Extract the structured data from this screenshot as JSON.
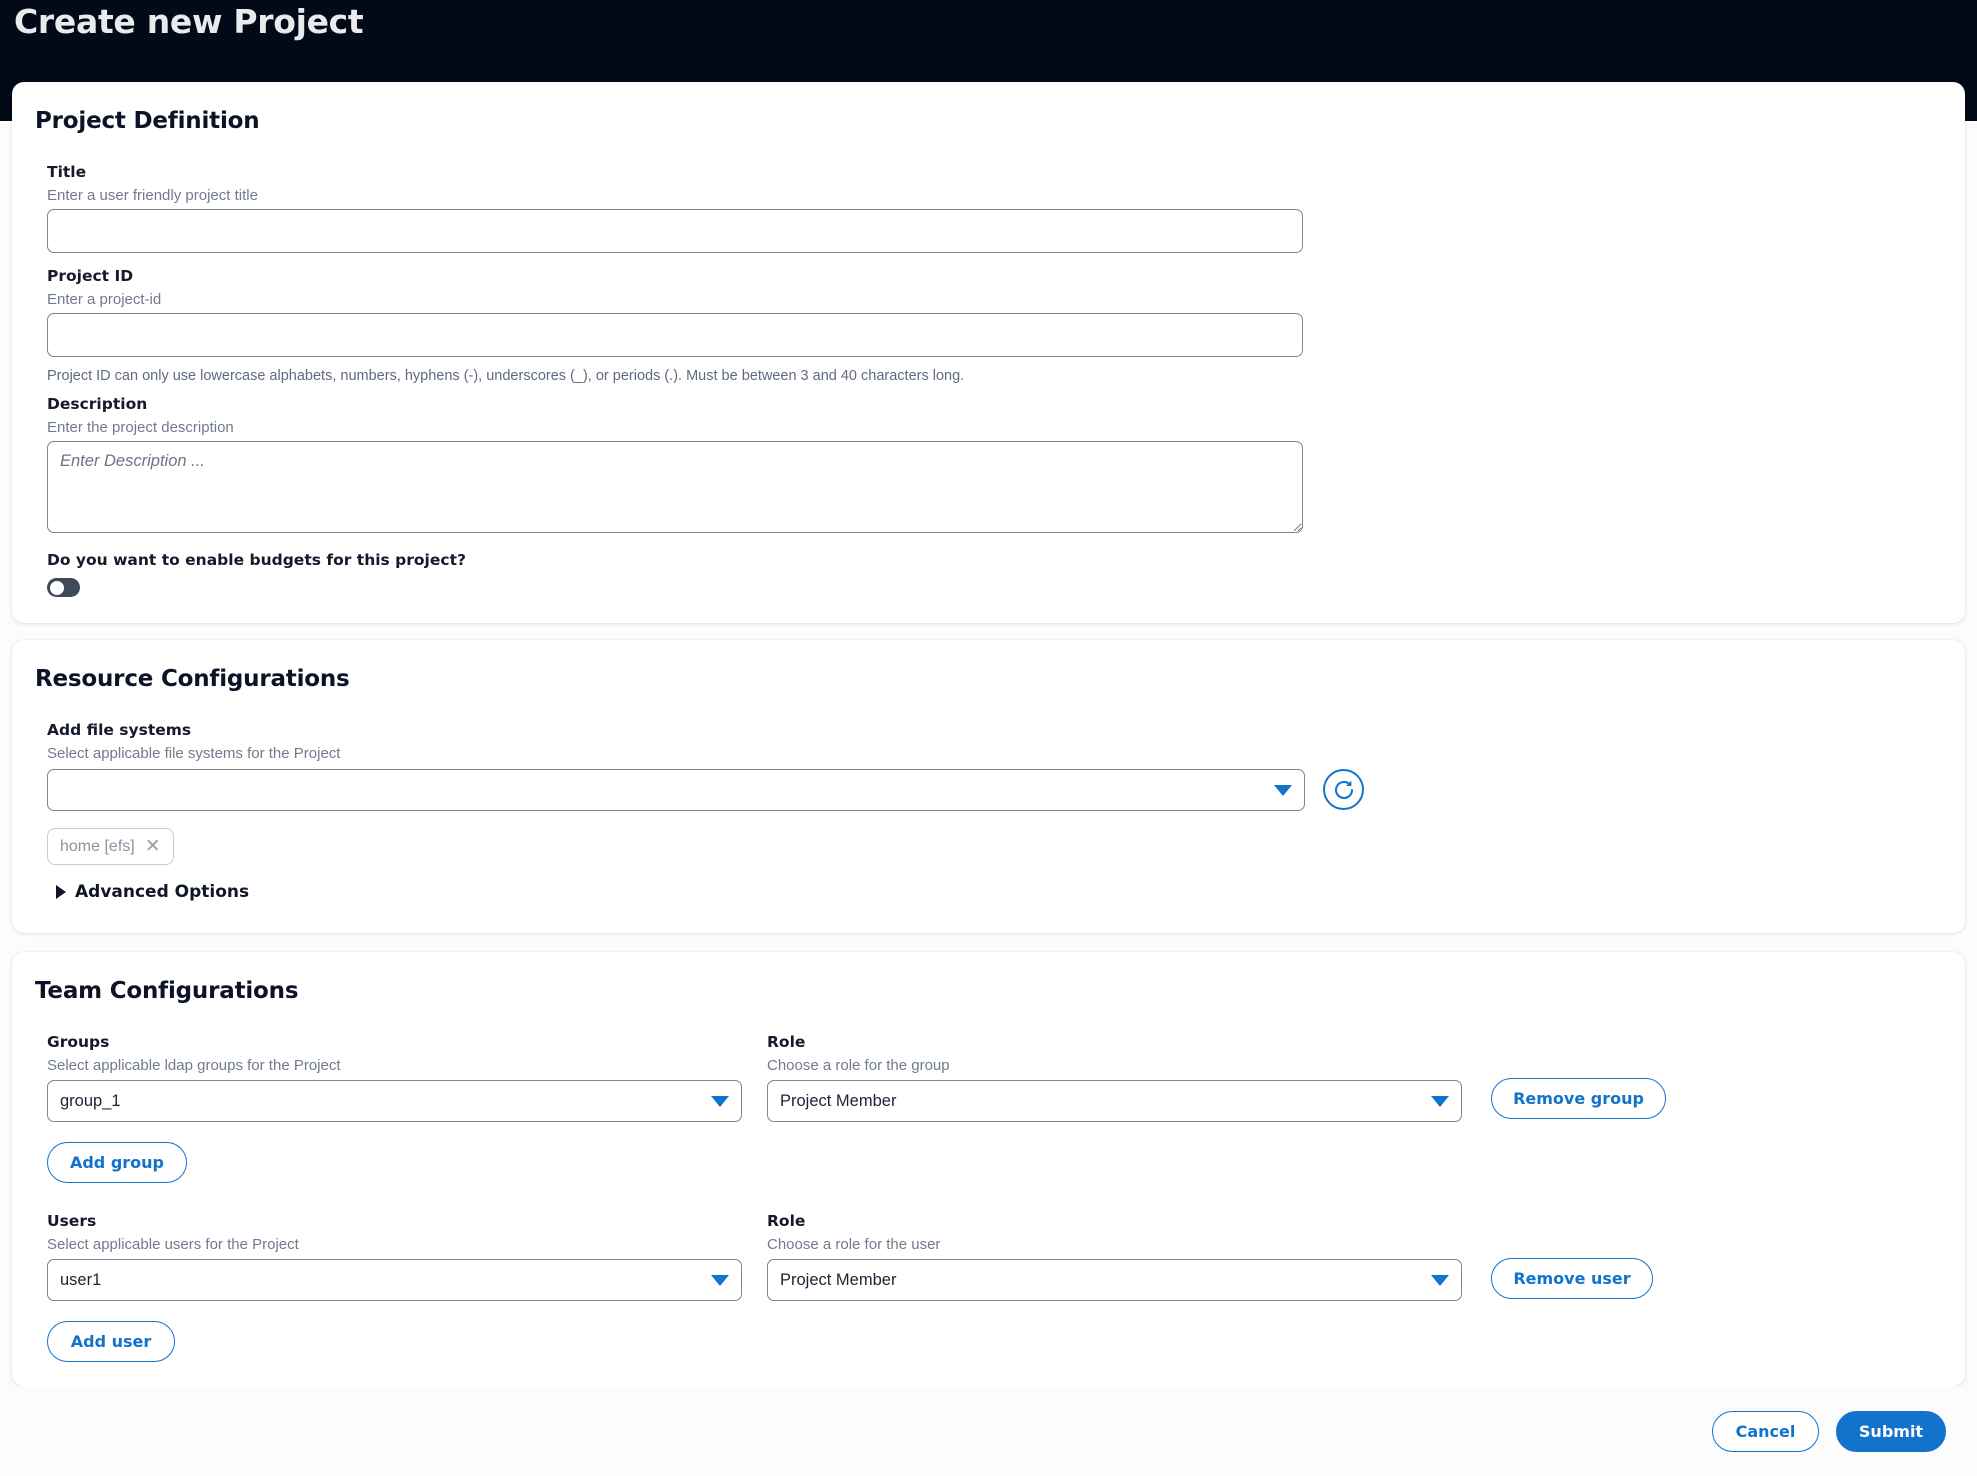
{
  "header": {
    "title": "Create new Project"
  },
  "project_definition": {
    "section_title": "Project Definition",
    "title_field": {
      "label": "Title",
      "hint": "Enter a user friendly project title",
      "value": "",
      "placeholder": ""
    },
    "project_id": {
      "label": "Project ID",
      "hint": "Enter a project-id",
      "value": "",
      "placeholder": "",
      "help": "Project ID can only use lowercase alphabets, numbers, hyphens (-), underscores (_), or periods (.). Must be between 3 and 40 characters long."
    },
    "description": {
      "label": "Description",
      "hint": "Enter the project description",
      "value": "",
      "placeholder": "Enter Description ..."
    },
    "budget_toggle": {
      "label": "Do you want to enable budgets for this project?",
      "state": "off"
    }
  },
  "resource_configurations": {
    "section_title": "Resource Configurations",
    "file_systems": {
      "label": "Add file systems",
      "hint": "Select applicable file systems for the Project",
      "selected_value": "",
      "refresh_icon": "refresh-icon",
      "dropdown_icon": "chevron-down-icon",
      "chips": [
        {
          "label": "home [efs]",
          "remove_icon": "close-icon"
        }
      ]
    },
    "advanced_options": {
      "label": "Advanced Options",
      "expand_icon": "triangle-right-icon",
      "expanded": "false"
    }
  },
  "team_configurations": {
    "section_title": "Team Configurations",
    "groups": {
      "label": "Groups",
      "hint": "Select applicable ldap groups for the Project",
      "value": "group_1",
      "role_label": "Role",
      "role_hint": "Choose a role for the group",
      "role_value": "Project Member",
      "remove_button": "Remove group",
      "add_button": "Add group"
    },
    "users": {
      "label": "Users",
      "hint": "Select applicable users for the Project",
      "value": "user1",
      "role_label": "Role",
      "role_hint": "Choose a role for the user",
      "role_value": "Project Member",
      "remove_button": "Remove user",
      "add_button": "Add user"
    }
  },
  "footer": {
    "cancel_label": "Cancel",
    "submit_label": "Submit"
  },
  "colors": {
    "header_bg": "#020917",
    "accent_blue": "#1273cd",
    "text_dark": "#111627",
    "muted": "#717b8c",
    "border": "#7b8595"
  }
}
